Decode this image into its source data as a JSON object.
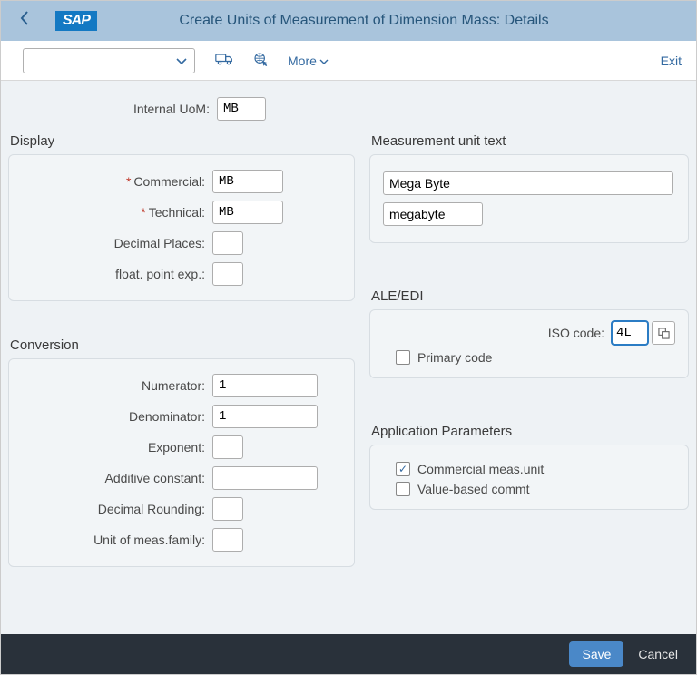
{
  "header": {
    "logo": "SAP",
    "title": "Create Units of Measurement of Dimension Mass: Details"
  },
  "toolbar": {
    "more_label": "More",
    "exit_label": "Exit"
  },
  "internal": {
    "label": "Internal UoM:",
    "value": "MB"
  },
  "display": {
    "title": "Display",
    "commercial_label": "Commercial:",
    "commercial_value": "MB",
    "technical_label": "Technical:",
    "technical_value": "MB",
    "decimal_label": "Decimal Places:",
    "decimal_value": "",
    "float_label": "float. point exp.:",
    "float_value": ""
  },
  "conversion": {
    "title": "Conversion",
    "numerator_label": "Numerator:",
    "numerator_value": "1",
    "denominator_label": "Denominator:",
    "denominator_value": "1",
    "exponent_label": "Exponent:",
    "exponent_value": "",
    "additive_label": "Additive constant:",
    "additive_value": "",
    "rounding_label": "Decimal Rounding:",
    "rounding_value": "",
    "family_label": "Unit of meas.family:",
    "family_value": ""
  },
  "meastext": {
    "title": "Measurement unit text",
    "long_value": "Mega Byte",
    "short_value": "megabyte"
  },
  "aleedi": {
    "title": "ALE/EDI",
    "iso_label": "ISO code:",
    "iso_value": "4L",
    "primary_label": "Primary code",
    "primary_checked": false
  },
  "appparams": {
    "title": "Application Parameters",
    "commercial_label": "Commercial meas.unit",
    "commercial_checked": true,
    "valuebased_label": "Value-based commt",
    "valuebased_checked": false
  },
  "footer": {
    "save_label": "Save",
    "cancel_label": "Cancel"
  }
}
